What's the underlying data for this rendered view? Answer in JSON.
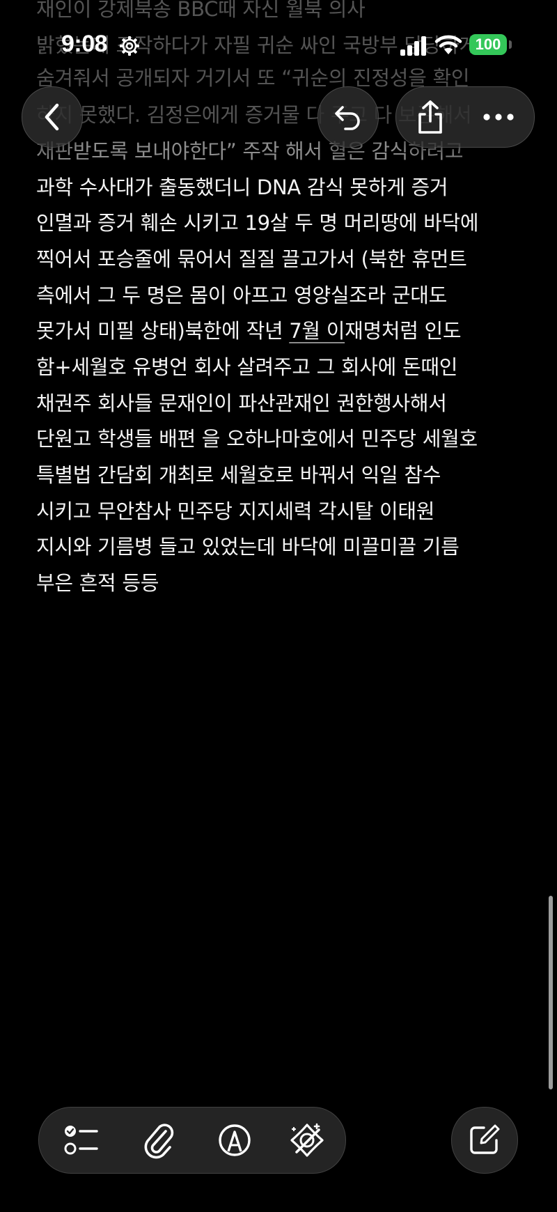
{
  "note": {
    "lines": [
      "재인이 강제북송 BBC때 자신 월북 의사",
      "밝혔는데 조작하다가 자필 귀순 싸인 국방부 당당하게 안",
      "숨겨줘서 공개되자 거기서 또  “귀순의 진정성을 확인",
      "하지 못했다. 김정은에게 증거물 다 주고 다 보존해서",
      "재판받도록 보내야한다” 주작 해서 혈은 감식하려고",
      "과학 수사대가 출동했더니 DNA 감식 못하게 증거",
      "인멸과 증거 훼손 시키고 19살 두 명 머리땅에 바닥에",
      "찍어서 포승줄에 묶어서 질질 끌고가서 (북한 휴먼트",
      "측에서 그 두 명은 몸이 아프고 영양실조라 군대도",
      "못가서 미필 상태)북한에 작년 7월 이재명처럼 인도",
      "함+세월호 유병언 회사 살려주고 그 회사에 돈때인",
      "채권주 회사들 문재인이 파산관재인 권한행사해서",
      "단원고 학생들 배편 을 오하나마호에서 민주당 세월호",
      "특별법 간담회 개최로 세월호로 바꿔서 익일 참수",
      "시키고 무안참사 민주당 지지세력 각시탈 이태원",
      "지시와 기름병 들고 있었는데 바닥에 미끌미끌 기름",
      "부은 흔적 등등"
    ],
    "line9_parts": {
      "before": "못가서 미필 상태)북한에 작년 ",
      "underlined": "7월 이",
      "after": "재명처럼 인도"
    }
  },
  "status_bar": {
    "time": "9:08",
    "battery": "100",
    "icons": [
      "gear-icon",
      "cellular-signal-icon",
      "wifi-icon",
      "battery-icon"
    ]
  },
  "nav": {
    "icons": [
      "chevron-left-icon",
      "undo-icon",
      "share-icon",
      "more-icon"
    ]
  },
  "toolbar": {
    "icons": [
      "checklist-icon",
      "paperclip-icon",
      "markup-pen-icon",
      "writing-tools-icon",
      "compose-icon"
    ]
  },
  "colors": {
    "background": "#000000",
    "text": "#f4f4f4",
    "battery": "#34c759",
    "glass": "#2d2d2d"
  }
}
